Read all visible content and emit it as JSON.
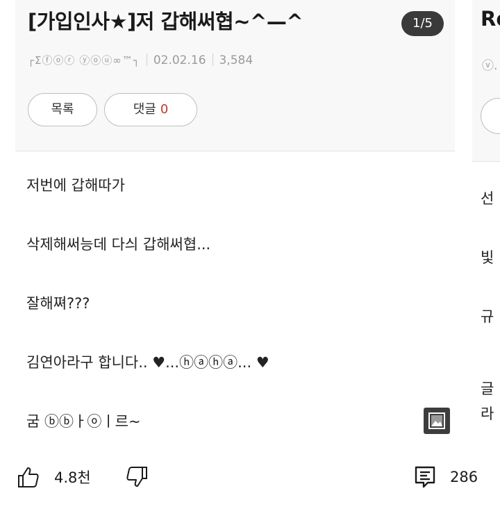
{
  "post": {
    "title": "[가입인사★]저 갑해써협~^—^",
    "pager": "1/5",
    "author": "┌Σⓕⓞⓡ ⓨⓞⓤ∞™┐",
    "date": "02.02.16",
    "views": "3,584",
    "list_button": "목록",
    "comment_button": "댓글",
    "comment_count": "0",
    "body": [
      "저번에 갑해따가",
      "삭제해써능데 다싀 갑해써협...",
      "잘해쪄???",
      "김연아라구 합니다.. ♥...ⓗⓐⓗⓐ... ♥",
      "굼 ⓑⓑㅏⓞㅣ르~"
    ]
  },
  "next_post": {
    "title": "Re",
    "meta": "ⓥ.",
    "body": [
      "선",
      "빛",
      "규",
      "글",
      "라"
    ]
  },
  "actions": {
    "likes": "4.8천",
    "comments": "286"
  },
  "colors": {
    "comment_count": "#c0392b",
    "header_bg": "#f8f8f8"
  }
}
